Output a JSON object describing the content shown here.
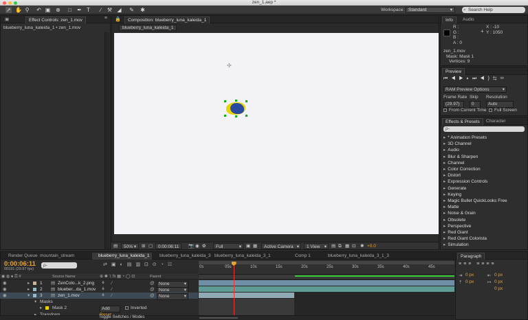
{
  "window": {
    "title": "zen_1.aep *"
  },
  "toolbar": {
    "workspace_label": "Workspace:",
    "workspace_value": "Standard",
    "search_placeholder": "Search Help"
  },
  "effect_controls": {
    "tab": "Effect Controls: zen_1.mov",
    "breadcrumb": "blueberry_luna_kaleida_1 • zen_1.mov"
  },
  "composition": {
    "tab": "Composition: blueberry_luna_kaleida_1",
    "subtab": "blueberry_luna_kaleida_1",
    "zoom": "50%",
    "timecode": "0:00:06:11",
    "resolution": "Full",
    "camera": "Active Camera",
    "view": "1 View",
    "exposure": "+0.0"
  },
  "info": {
    "tabs": [
      "Info",
      "Audio"
    ],
    "r": "R :",
    "g": "G :",
    "b": "B :",
    "a": "A : 0",
    "x": "X : -10",
    "y": "Y : 1050",
    "line1": "zen_1.mov",
    "line2": "Mask: Mask 1",
    "line3": "Vertices: 9"
  },
  "preview": {
    "tab": "Preview",
    "options": "RAM Preview Options",
    "frame_rate_label": "Frame Rate",
    "skip_label": "Skip",
    "resolution_label": "Resolution",
    "frame_rate": "(29.97)",
    "skip": "0",
    "resolution": "Auto",
    "from_current": "From Current Time",
    "full_screen": "Full Screen"
  },
  "effects": {
    "tabs": [
      "Effects & Presets",
      "Character"
    ],
    "search_placeholder": "ρ-",
    "items": [
      "* Animation Presets",
      "3D Channel",
      "Audio",
      "Blur & Sharpen",
      "Channel",
      "Color Correction",
      "Distort",
      "Expression Controls",
      "Generate",
      "Keying",
      "Magic Bullet QuickLooks Free",
      "Matte",
      "Noise & Grain",
      "Obsolete",
      "Perspective",
      "Red Giant",
      "Red Giant Colorista",
      "Simulation"
    ]
  },
  "timeline": {
    "tabs": [
      "Render Queue",
      "mountain_stream",
      "blueberry_luna_kaleida_1",
      "blueberry_luna_kaleida_3",
      "blueberry_luna_kaleida_3_1",
      "Comp 1",
      "blueberry_luna_kaleida_3_1_3"
    ],
    "timecode": "0:00:06:11",
    "frames": "00191 (29.97 fps)",
    "search_placeholder": "ρ-",
    "col_source": "Source Name",
    "col_parent": "Parent",
    "ruler": [
      "0s",
      "05s",
      "10s",
      "15s",
      "20s",
      "25s",
      "30s",
      "35s",
      "40s",
      "45s"
    ],
    "layers": [
      {
        "num": "1",
        "name": "ZenColo...k_2.png",
        "parent": "None"
      },
      {
        "num": "2",
        "name": "blueber...da_1.mov",
        "parent": "None"
      },
      {
        "num": "3",
        "name": "zen_1.mov",
        "parent": "None"
      }
    ],
    "masks_label": "Masks",
    "mask2_label": "Mask 2",
    "mask_mode": "Add",
    "inverted": "Inverted",
    "transform_label": "Transform",
    "reset": "Reset",
    "toggle": "Toggle Switches / Modes",
    "playhead_frac": 0.136
  },
  "paragraph": {
    "tab": "Paragraph",
    "vals": [
      "0 px",
      "0 px",
      "0 px",
      "0 px",
      "0 px"
    ]
  },
  "colors": {
    "accent": "#e8a330",
    "track_blue": "#6f8fa6",
    "track_teal": "#5f9c95",
    "track_grey": "#777777"
  }
}
